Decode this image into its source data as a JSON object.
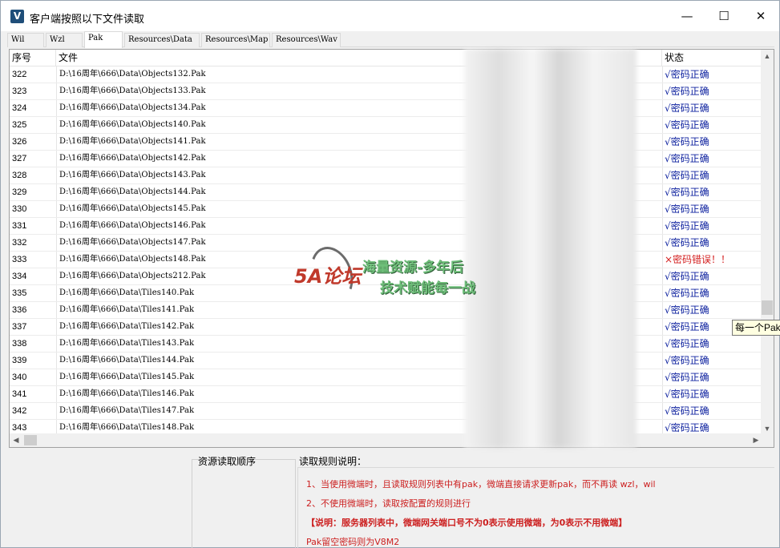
{
  "window": {
    "title": "客户端按照以下文件读取",
    "controls": {
      "minimize": "—",
      "maximize": "☐",
      "close": "✕"
    }
  },
  "tabs": [
    "Wil",
    "Wzl",
    "Pak",
    "Resources\\Data",
    "Resources\\Map",
    "Resources\\Wav"
  ],
  "active_tab": "Pak",
  "list": {
    "columns": {
      "seq": "序号",
      "file": "文件",
      "status": "状态"
    },
    "rows": [
      {
        "seq": "322",
        "file": "D:\\16周年\\666\\Data\\Objects132.Pak",
        "status": "√密码正确"
      },
      {
        "seq": "323",
        "file": "D:\\16周年\\666\\Data\\Objects133.Pak",
        "status": "√密码正确"
      },
      {
        "seq": "324",
        "file": "D:\\16周年\\666\\Data\\Objects134.Pak",
        "status": "√密码正确"
      },
      {
        "seq": "325",
        "file": "D:\\16周年\\666\\Data\\Objects140.Pak",
        "status": "√密码正确"
      },
      {
        "seq": "326",
        "file": "D:\\16周年\\666\\Data\\Objects141.Pak",
        "status": "√密码正确"
      },
      {
        "seq": "327",
        "file": "D:\\16周年\\666\\Data\\Objects142.Pak",
        "status": "√密码正确"
      },
      {
        "seq": "328",
        "file": "D:\\16周年\\666\\Data\\Objects143.Pak",
        "status": "√密码正确"
      },
      {
        "seq": "329",
        "file": "D:\\16周年\\666\\Data\\Objects144.Pak",
        "status": "√密码正确"
      },
      {
        "seq": "330",
        "file": "D:\\16周年\\666\\Data\\Objects145.Pak",
        "status": "√密码正确"
      },
      {
        "seq": "331",
        "file": "D:\\16周年\\666\\Data\\Objects146.Pak",
        "status": "√密码正确"
      },
      {
        "seq": "332",
        "file": "D:\\16周年\\666\\Data\\Objects147.Pak",
        "status": "√密码正确"
      },
      {
        "seq": "333",
        "file": "D:\\16周年\\666\\Data\\Objects148.Pak",
        "status": "×密码错误！！",
        "error": true
      },
      {
        "seq": "334",
        "file": "D:\\16周年\\666\\Data\\Objects212.Pak",
        "status": "√密码正确"
      },
      {
        "seq": "335",
        "file": "D:\\16周年\\666\\Data\\Tiles140.Pak",
        "status": "√密码正确"
      },
      {
        "seq": "336",
        "file": "D:\\16周年\\666\\Data\\Tiles141.Pak",
        "status": "√密码正确"
      },
      {
        "seq": "337",
        "file": "D:\\16周年\\666\\Data\\Tiles142.Pak",
        "status": "√密码正确"
      },
      {
        "seq": "338",
        "file": "D:\\16周年\\666\\Data\\Tiles143.Pak",
        "status": "√密码正确"
      },
      {
        "seq": "339",
        "file": "D:\\16周年\\666\\Data\\Tiles144.Pak",
        "status": "√密码正确"
      },
      {
        "seq": "340",
        "file": "D:\\16周年\\666\\Data\\Tiles145.Pak",
        "status": "√密码正确"
      },
      {
        "seq": "341",
        "file": "D:\\16周年\\666\\Data\\Tiles146.Pak",
        "status": "√密码正确"
      },
      {
        "seq": "342",
        "file": "D:\\16周年\\666\\Data\\Tiles147.Pak",
        "status": "√密码正确"
      },
      {
        "seq": "343",
        "file": "D:\\16周年\\666\\Data\\Tiles148.Pak",
        "status": "√密码正确"
      }
    ]
  },
  "tooltip": "每一个Pak",
  "watermark": {
    "logo": "5A论坛",
    "line1": "海量资源-多年后",
    "line2": "技术赋能每一战"
  },
  "bottom": {
    "order_label": "资源读取顺序",
    "rules_label": "读取规则说明：",
    "rules": [
      "1、当使用微端时，且读取规则列表中有pak，微端直接请求更新pak，而不再读 wzl，wil",
      "2、不使用微端时，读取按配置的规则进行",
      "【说明：服务器列表中，微端网关端口号不为0表示使用微端，为0表示不用微端】",
      "Pak留空密码则为V8M2"
    ]
  },
  "colors": {
    "status_ok": "#0b1f9e",
    "status_error": "#d42020",
    "rules_text": "#cc1f1f"
  }
}
